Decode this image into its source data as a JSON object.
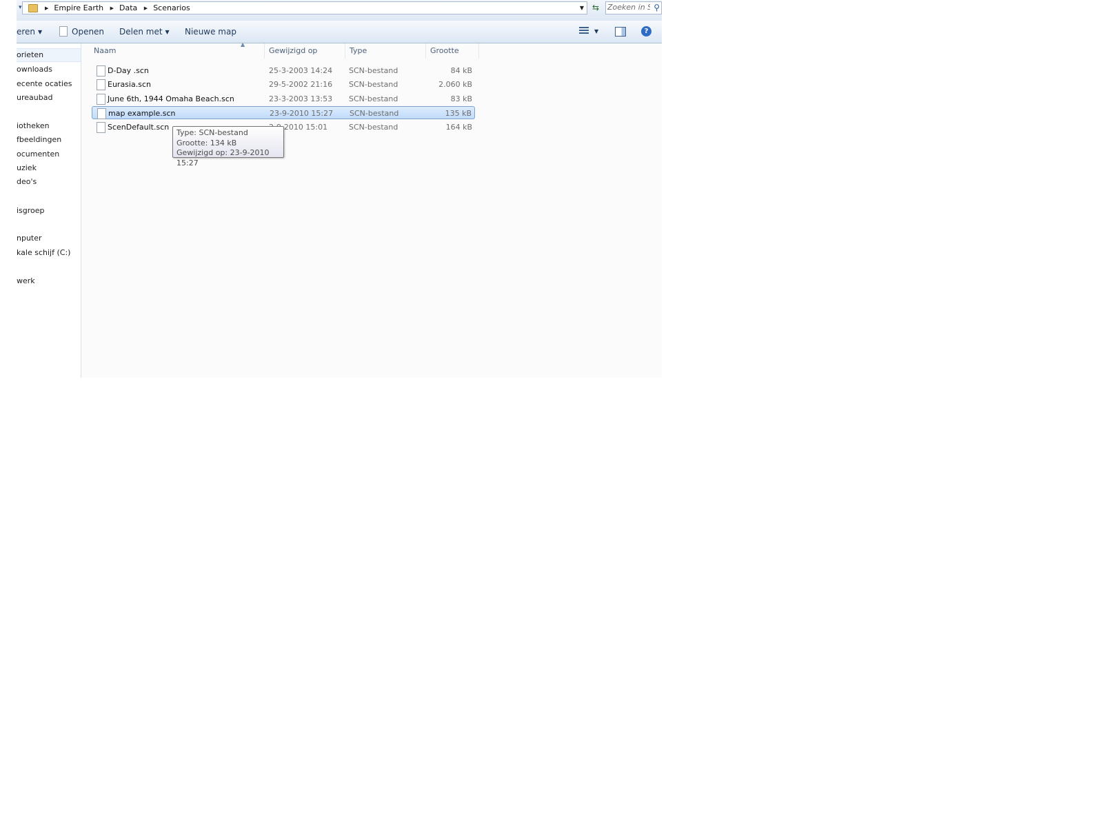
{
  "address_bar": {
    "breadcrumbs": [
      "Empire Earth",
      "Data",
      "Scenarios"
    ],
    "search_placeholder": "Zoeken in S..."
  },
  "toolbar": {
    "organize_label": "eren",
    "open_label": "Openen",
    "share_label": "Delen met",
    "new_folder_label": "Nieuwe map"
  },
  "nav": {
    "items": [
      "orieten",
      "ownloads",
      "ecente ocaties",
      "ureaubad",
      "iotheken",
      "fbeeldingen",
      "ocumenten",
      "uziek",
      "deo's",
      "isgroep",
      "nputer",
      "kale schijf (C:)",
      "werk"
    ]
  },
  "columns": {
    "name": "Naam",
    "modified": "Gewijzigd op",
    "type": "Type",
    "size": "Grootte"
  },
  "files": [
    {
      "name": "D-Day .scn",
      "modified": "25-3-2003 14:24",
      "type": "SCN-bestand",
      "size": "84 kB"
    },
    {
      "name": "Eurasia.scn",
      "modified": "29-5-2002 21:16",
      "type": "SCN-bestand",
      "size": "2.060 kB"
    },
    {
      "name": "June 6th, 1944 Omaha Beach.scn",
      "modified": "23-3-2003 13:53",
      "type": "SCN-bestand",
      "size": "83 kB"
    },
    {
      "name": "map example.scn",
      "modified": "23-9-2010 15:27",
      "type": "SCN-bestand",
      "size": "135 kB"
    },
    {
      "name": "ScenDefault.scn",
      "modified": "2-9-2010 15:01",
      "type": "SCN-bestand",
      "size": "164 kB"
    }
  ],
  "tooltip": {
    "line1": "Type: SCN-bestand",
    "line2": "Grootte: 134 kB",
    "line3": "Gewijzigd op: 23-9-2010 15:27"
  },
  "colors": {
    "selection": "#c1dcfc",
    "selection_border": "#7da2ce",
    "toolbar_text": "#1e395b"
  }
}
